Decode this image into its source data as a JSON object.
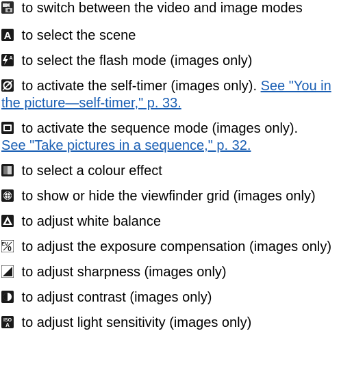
{
  "items": [
    {
      "icon": "video-image-mode-icon",
      "text": " to switch between the video and image modes"
    },
    {
      "icon": "scene-auto-icon",
      "text": " to select the scene"
    },
    {
      "icon": "flash-auto-icon",
      "text": " to select the flash mode (images only)"
    },
    {
      "icon": "self-timer-icon",
      "text": " to activate the self-timer (images only). ",
      "link": "See \"You in the picture—self-timer,\" p. 33."
    },
    {
      "icon": "sequence-mode-icon",
      "text": " to activate the sequence mode (images only).",
      "link": "See \"Take pictures in a sequence,\" p. 32."
    },
    {
      "icon": "colour-effect-icon",
      "text": " to select a colour effect"
    },
    {
      "icon": "viewfinder-grid-icon",
      "text": " to show or hide the viewfinder grid (images only)"
    },
    {
      "icon": "white-balance-icon",
      "text": " to adjust white balance"
    },
    {
      "icon": "exposure-compensation-icon",
      "text": " to adjust the exposure compensation (images only)"
    },
    {
      "icon": "sharpness-icon",
      "text": " to adjust sharpness (images only)"
    },
    {
      "icon": "contrast-icon",
      "text": " to adjust contrast (images only)"
    },
    {
      "icon": "iso-icon",
      "text": " to adjust light sensitivity (images only)"
    }
  ],
  "colors": {
    "link": "#1a5fb4",
    "icon": "#1a1a1a"
  }
}
